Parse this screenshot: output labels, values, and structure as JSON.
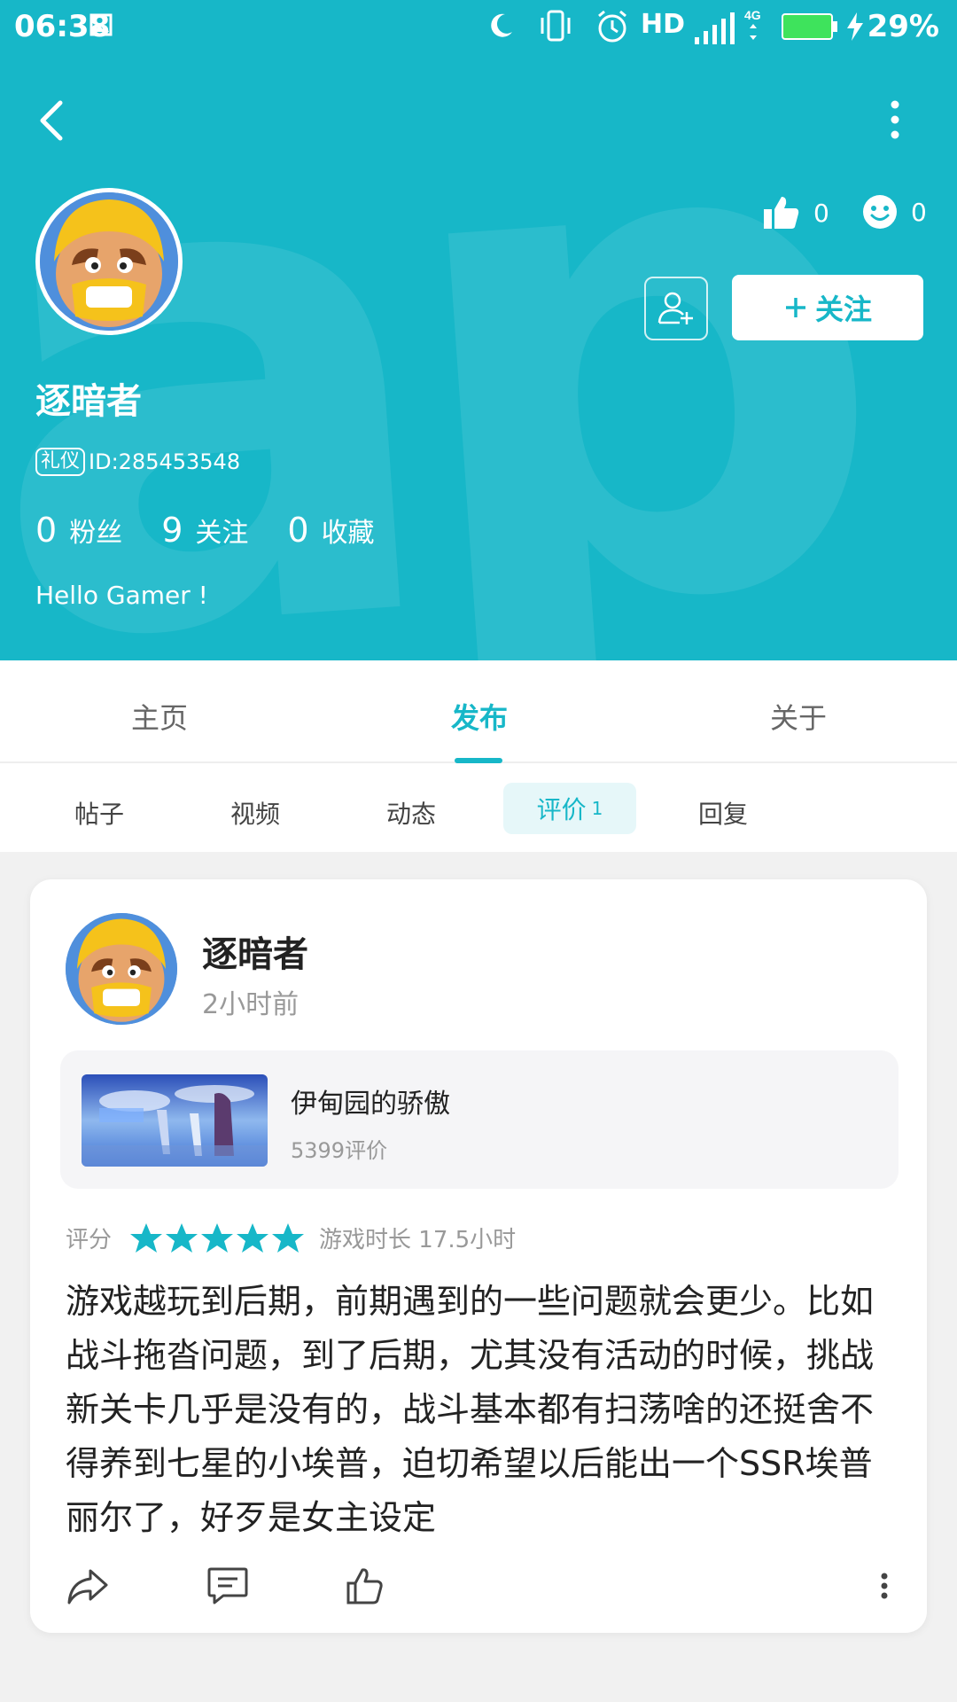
{
  "status_bar": {
    "time": "06:38",
    "hd": "HD",
    "network": "4G",
    "battery": "29%"
  },
  "profile": {
    "name": "逐暗者",
    "tag": "礼仪",
    "id": "ID:285453548",
    "stats": [
      {
        "num": "0",
        "label": "粉丝"
      },
      {
        "num": "9",
        "label": "关注"
      },
      {
        "num": "0",
        "label": "收藏"
      }
    ],
    "bio": "Hello Gamer !",
    "likes": "0",
    "smiles": "0",
    "follow_label": "关注"
  },
  "tabs": [
    "主页",
    "发布",
    "关于"
  ],
  "subtabs": [
    "帖子",
    "视频",
    "动态",
    "评价",
    "回复"
  ],
  "subtab_active_count": "1",
  "post": {
    "author": "逐暗者",
    "time": "2小时前",
    "game": {
      "title": "伊甸园的骄傲",
      "review_count": "5399评价"
    },
    "rating_label": "评分",
    "rating_stars": 5,
    "playtime": "游戏时长 17.5小时",
    "text": "游戏越玩到后期，前期遇到的一些问题就会更少。比如战斗拖沓问题，到了后期，尤其没有活动的时候，挑战新关卡几乎是没有的，战斗基本都有扫荡啥的还挺舍不得养到七星的小埃普，迫切希望以后能出一个SSR埃普丽尔了，好歹是女主设定"
  },
  "colors": {
    "accent": "#17b7c8",
    "star": "#17b7c8"
  },
  "icons": [
    "back-icon",
    "more-icon",
    "thumbs-up-icon",
    "smile-icon",
    "add-friend-icon",
    "plus-icon",
    "share-icon",
    "comment-icon",
    "like-icon",
    "more-vertical-icon"
  ]
}
